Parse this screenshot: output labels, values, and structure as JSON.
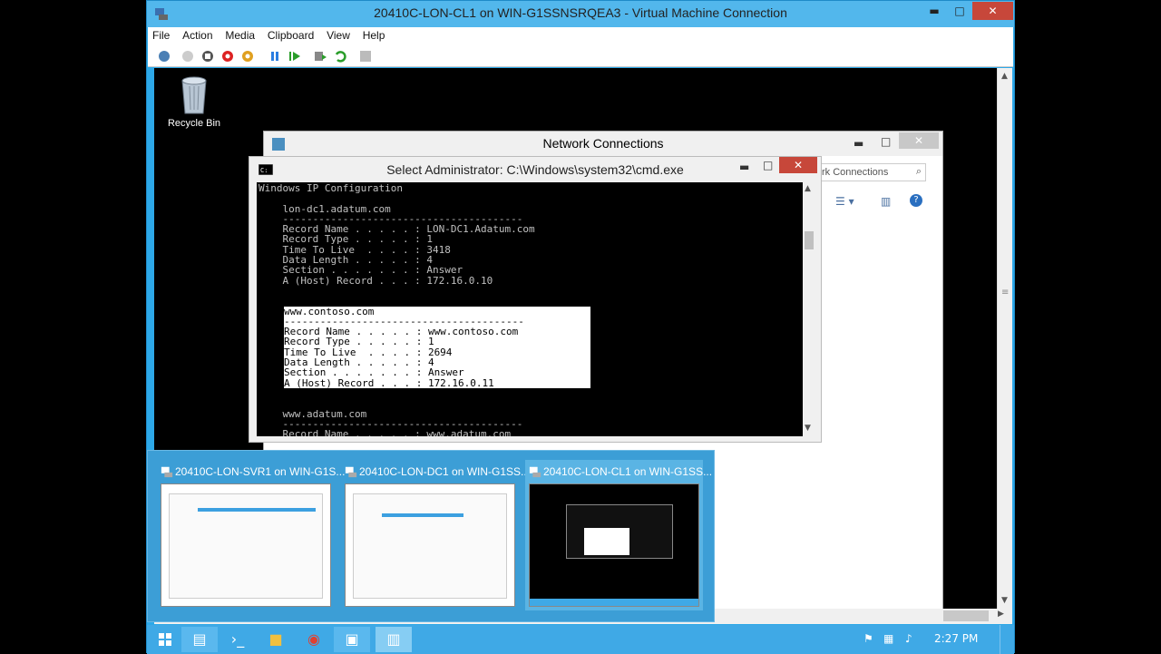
{
  "window": {
    "title": "20410C-LON-CL1 on WIN-G1SSNSRQEA3 - Virtual Machine Connection",
    "min": "▬",
    "max": "□",
    "close": "✕"
  },
  "menu": [
    "File",
    "Action",
    "Media",
    "Clipboard",
    "View",
    "Help"
  ],
  "desktop": {
    "recycle_bin": "Recycle Bin"
  },
  "netconn": {
    "title": "Network Connections",
    "search_placeholder": "rk Connections"
  },
  "cmd": {
    "title": "Select Administrator: C:\\Windows\\system32\\cmd.exe",
    "lines": [
      "Windows IP Configuration",
      "",
      "    lon-dc1.adatum.com",
      "    ----------------------------------------",
      "    Record Name . . . . . : LON-DC1.Adatum.com",
      "    Record Type . . . . . : 1",
      "    Time To Live  . . . . : 3418",
      "    Data Length . . . . . : 4",
      "    Section . . . . . . . : Answer",
      "    A (Host) Record . . . : 172.16.0.10",
      "",
      "",
      "    www.contoso.com",
      "    ----------------------------------------",
      "    Record Name . . . . . : www.contoso.com",
      "    Record Type . . . . . : 1",
      "    Time To Live  . . . . : 2694",
      "    Data Length . . . . . : 4",
      "    Section . . . . . . . : Answer",
      "    A (Host) Record . . . : 172.16.0.11",
      "",
      "",
      "    www.adatum.com",
      "    ----------------------------------------",
      "    Record Name . . . . . : www.adatum.com"
    ],
    "highlight_range": [
      12,
      19
    ]
  },
  "switcher": {
    "items": [
      "20410C-LON-SVR1 on WIN-G1S...",
      "20410C-LON-DC1 on WIN-G1SS...",
      "20410C-LON-CL1 on WIN-G1SS..."
    ],
    "active_index": 2
  },
  "taskbar": {
    "clock": "2:27 PM"
  }
}
